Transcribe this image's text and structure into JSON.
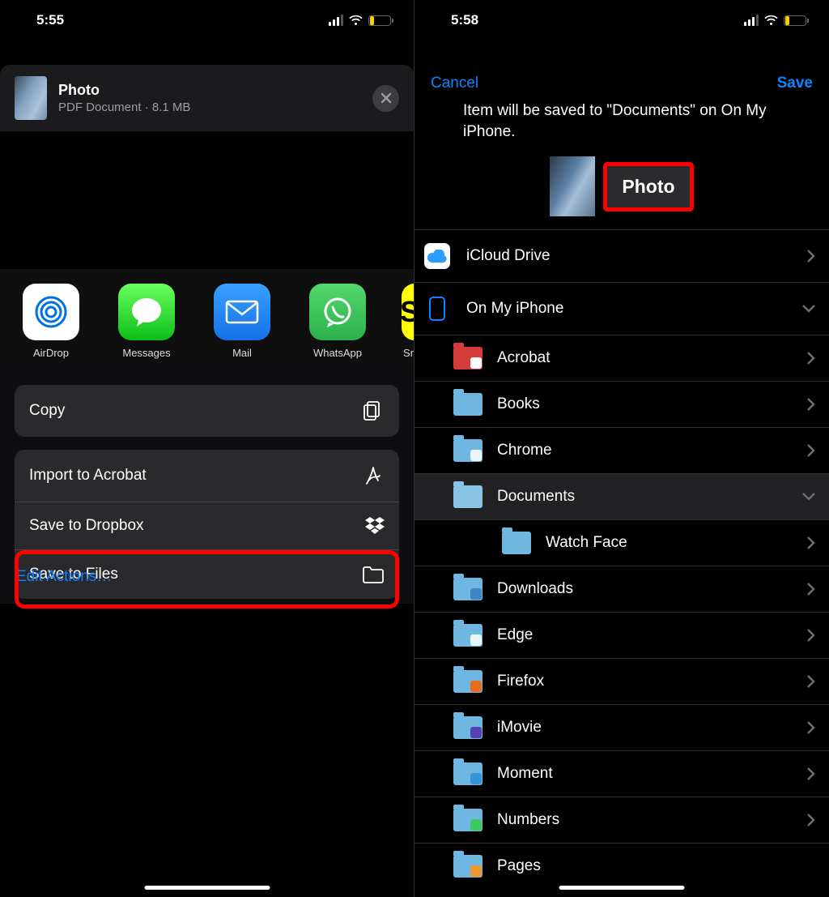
{
  "left": {
    "time": "5:55",
    "file": {
      "title": "Photo",
      "subtitle": "PDF Document · 8.1 MB"
    },
    "apps": [
      {
        "id": "airdrop",
        "label": "AirDrop"
      },
      {
        "id": "messages",
        "label": "Messages"
      },
      {
        "id": "mail",
        "label": "Mail"
      },
      {
        "id": "whatsapp",
        "label": "WhatsApp"
      },
      {
        "id": "snap",
        "label": "Sn"
      }
    ],
    "copy": "Copy",
    "actions": [
      {
        "label": "Import to Acrobat",
        "icon": "acrobat"
      },
      {
        "label": "Save to Dropbox",
        "icon": "dropbox"
      },
      {
        "label": "Save to Files",
        "icon": "folder"
      }
    ],
    "edit": "Edit Actions…"
  },
  "right": {
    "time": "5:58",
    "cancel": "Cancel",
    "save": "Save",
    "message": "Item will be saved to \"Documents\" on On My iPhone.",
    "filename": "Photo",
    "locations": {
      "icloud": "iCloud Drive",
      "phone": "On My iPhone",
      "items": [
        "Acrobat",
        "Books",
        "Chrome",
        "Documents",
        "Watch Face",
        "Downloads",
        "Edge",
        "Firefox",
        "iMovie",
        "Moment",
        "Numbers",
        "Pages"
      ]
    }
  }
}
